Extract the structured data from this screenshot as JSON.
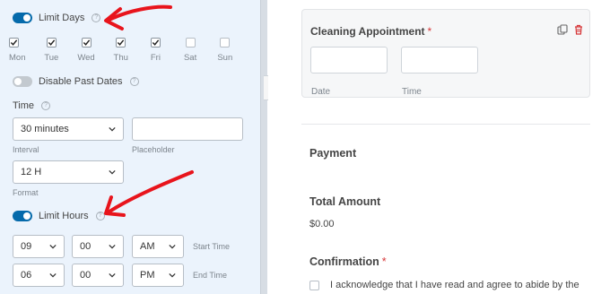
{
  "left_panel": {
    "limit_days": {
      "label": "Limit Days",
      "on": true
    },
    "days": [
      {
        "label": "Mon",
        "checked": true
      },
      {
        "label": "Tue",
        "checked": true
      },
      {
        "label": "Wed",
        "checked": true
      },
      {
        "label": "Thu",
        "checked": true
      },
      {
        "label": "Fri",
        "checked": true
      },
      {
        "label": "Sat",
        "checked": false
      },
      {
        "label": "Sun",
        "checked": false
      }
    ],
    "disable_past_dates": {
      "label": "Disable Past Dates",
      "on": false
    },
    "time": {
      "label": "Time",
      "interval_value": "30 minutes",
      "interval_label": "Interval",
      "placeholder_value": "",
      "placeholder_label": "Placeholder",
      "format_value": "12 H",
      "format_label": "Format"
    },
    "limit_hours": {
      "label": "Limit Hours",
      "on": true
    },
    "start_time": {
      "hour": "09",
      "minute": "00",
      "ampm": "AM",
      "label": "Start Time"
    },
    "end_time": {
      "hour": "06",
      "minute": "00",
      "ampm": "PM",
      "label": "End Time"
    },
    "help_glyph": "?"
  },
  "collapse_glyph": "‹",
  "right_panel": {
    "appointment": {
      "title": "Cleaning Appointment",
      "required_mark": "*",
      "date_label": "Date",
      "time_label": "Time"
    },
    "payment_title": "Payment",
    "total_amount_title": "Total Amount",
    "total_amount_value": "$0.00",
    "confirmation_title": "Confirmation",
    "confirmation_required": "*",
    "confirmation_text": "I acknowledge that I have read and agree to abide by the"
  },
  "colors": {
    "accent": "#056aab",
    "panel_bg": "#ebf3fc",
    "arrow": "#e8141c",
    "required": "#d63638"
  },
  "icons": [
    "help-icon",
    "chevron-down-icon",
    "checkmark-icon",
    "duplicate-icon",
    "trash-icon",
    "collapse-chevron-icon",
    "annotation-arrow"
  ]
}
